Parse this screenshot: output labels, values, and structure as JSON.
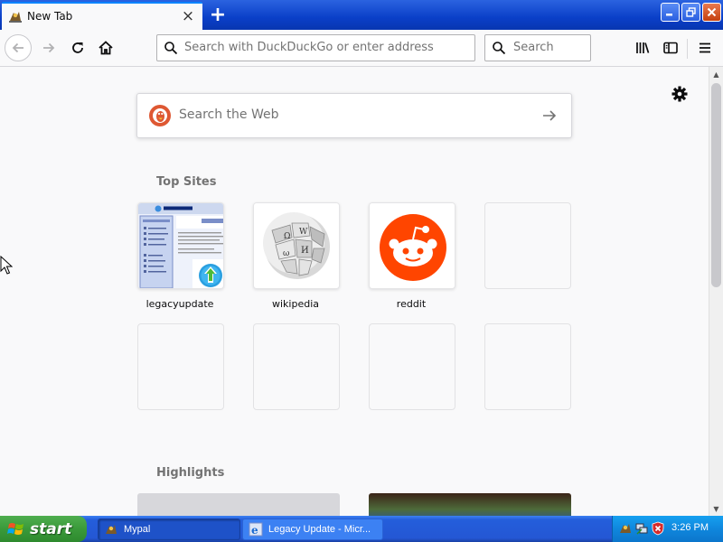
{
  "window": {
    "tab_title": "New Tab",
    "new_tab_symbol": "+",
    "close_tab_symbol": "×",
    "min_symbol": "–",
    "max_symbol": "❐",
    "close_symbol": "✕"
  },
  "toolbar": {
    "url_placeholder": "Search with DuckDuckGo or enter address",
    "search_placeholder": "Search"
  },
  "content": {
    "web_search_placeholder": "Search the Web",
    "top_sites_title": "Top Sites",
    "highlights_title": "Highlights",
    "top_sites": [
      {
        "label": "legacyupdate",
        "icon": "legacyupdate-thumbnail"
      },
      {
        "label": "wikipedia",
        "icon": "wikipedia-globe-icon"
      },
      {
        "label": "reddit",
        "icon": "reddit-alien-icon"
      }
    ]
  },
  "taskbar": {
    "start_label": "start",
    "items": [
      {
        "label": "Mypal",
        "icon": "mypal-icon"
      },
      {
        "label": "Legacy Update - Micr...",
        "icon": "ie-icon"
      }
    ],
    "clock": "3:26 PM"
  },
  "colors": {
    "accent": "#0a84ff",
    "reddit": "#ff4500",
    "duckduckgo": "#de5833",
    "xp_taskbar": "#245edb",
    "xp_start": "#3a9a3a"
  }
}
